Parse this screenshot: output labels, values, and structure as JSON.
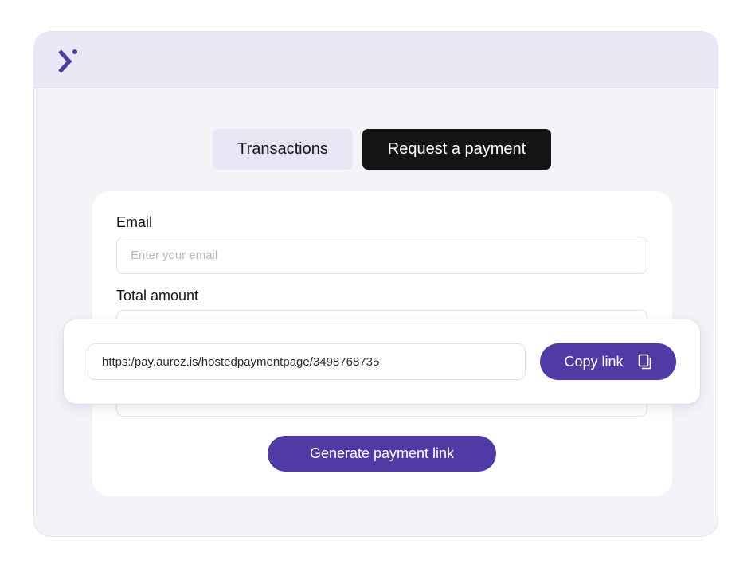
{
  "app": {
    "logo_icon": "chevron-right-dot-logo",
    "accent_color": "#4f3aa6"
  },
  "tabs": [
    {
      "label": "Transactions",
      "active": false
    },
    {
      "label": "Request a payment",
      "active": true
    }
  ],
  "form": {
    "email": {
      "label": "Email",
      "placeholder": "Enter your email",
      "value": ""
    },
    "total_amount": {
      "label": "Total amount",
      "value": ""
    },
    "generate_label": "Generate payment link"
  },
  "link_popover": {
    "link_value": "https:/pay.aurez.is/hostedpaymentpage/3498768735",
    "copy_label": "Copy link",
    "copy_icon": "copy-icon"
  }
}
